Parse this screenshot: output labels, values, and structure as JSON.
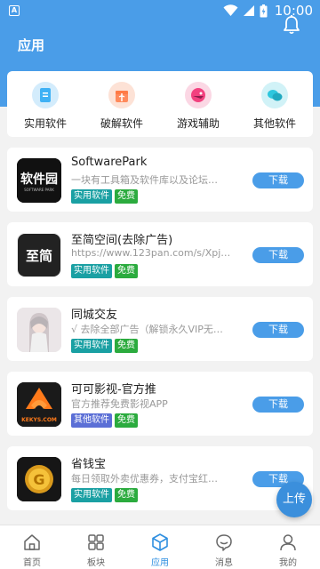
{
  "status_bar": {
    "app_indicator": "A",
    "time": "10:00",
    "icons": [
      "wifi-icon",
      "signal-icon",
      "battery-icon"
    ]
  },
  "header": {
    "title": "应用",
    "notification_icon": "bell-icon"
  },
  "categories": [
    {
      "label": "实用软件",
      "icon": "document-icon",
      "color": "#3fb1f5"
    },
    {
      "label": "破解软件",
      "icon": "gift-icon",
      "color": "#ff8a5c"
    },
    {
      "label": "游戏辅助",
      "icon": "game-icon",
      "color": "#f2417f"
    },
    {
      "label": "其他软件",
      "icon": "chat-icon",
      "color": "#2ec7de"
    }
  ],
  "apps": [
    {
      "name": "SoftwarePark",
      "description": "一块有工具箱及软件库以及论坛…",
      "tags": [
        {
          "label": "实用软件",
          "color": "#1aa0a3"
        },
        {
          "label": "免费",
          "color": "#2bab3e"
        }
      ],
      "icon_text": "软件园",
      "icon_subtext": "SOFTWARE PARK",
      "download_label": "下载"
    },
    {
      "name": "至简空间(去除广告)",
      "description": "https://www.123pan.com/s/Xpj…",
      "tags": [
        {
          "label": "实用软件",
          "color": "#1aa0a3"
        },
        {
          "label": "免费",
          "color": "#2bab3e"
        }
      ],
      "icon_text": "至简",
      "download_label": "下载"
    },
    {
      "name": "同城交友",
      "description": "√ 去除全部广告（解锁永久VIP无…",
      "tags": [
        {
          "label": "实用软件",
          "color": "#1aa0a3"
        },
        {
          "label": "免费",
          "color": "#2bab3e"
        }
      ],
      "download_label": "下载"
    },
    {
      "name": "可可影视-官方推",
      "description": "官方推荐免费影视APP",
      "tags": [
        {
          "label": "其他软件",
          "color": "#5b6fd6"
        },
        {
          "label": "免费",
          "color": "#2bab3e"
        }
      ],
      "icon_subtext": "KEKYS.COM",
      "download_label": "下载"
    },
    {
      "name": "省钱宝",
      "description": "每日领取外卖优惠券，支付宝红…",
      "tags": [
        {
          "label": "实用软件",
          "color": "#1aa0a3"
        },
        {
          "label": "免费",
          "color": "#2bab3e"
        }
      ],
      "icon_text": "G",
      "download_label": "下载"
    }
  ],
  "upload_button": "上传",
  "bottom_nav": [
    {
      "label": "首页",
      "icon": "home-icon"
    },
    {
      "label": "板块",
      "icon": "grid-icon"
    },
    {
      "label": "应用",
      "icon": "cube-icon",
      "active": true
    },
    {
      "label": "消息",
      "icon": "message-icon"
    },
    {
      "label": "我的",
      "icon": "user-icon"
    }
  ],
  "colors": {
    "primary": "#4a9de8",
    "active_nav": "#2f8fe0"
  }
}
